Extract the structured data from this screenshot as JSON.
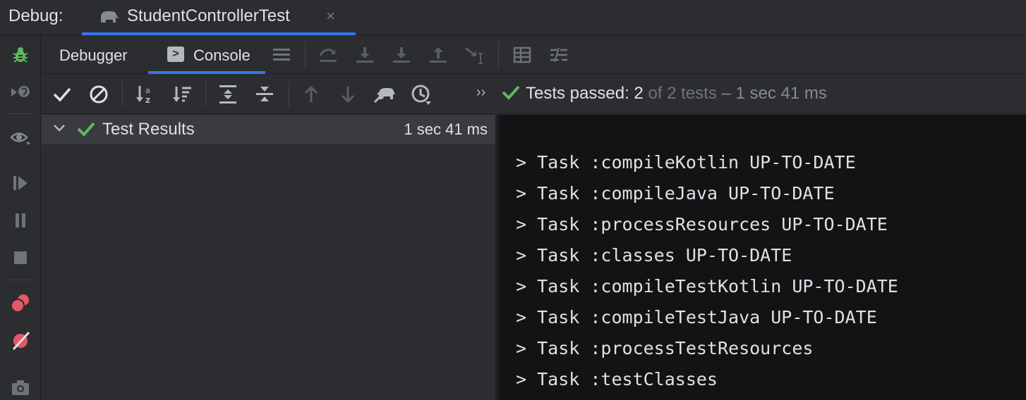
{
  "title_bar": {
    "debug_label": "Debug:",
    "run_tab_name": "StudentControllerTest",
    "close_glyph": "×",
    "run_icon": "gradle-elephant-icon"
  },
  "left_toolbar": {
    "icons": [
      "debug-bug-icon",
      "rerun-icon",
      "view-breakpoints-eye-icon",
      "resume-icon",
      "pause-icon",
      "stop-icon",
      "view-breakpoints-icon",
      "mute-breakpoints-icon",
      "camera-icon"
    ]
  },
  "tabs": {
    "debugger": "Debugger",
    "console": "Console",
    "console_glyph": ">"
  },
  "debugger_toolbar": {
    "icons": [
      "menu-icon",
      "step-over-icon",
      "step-into-icon",
      "force-step-into-icon",
      "step-out-icon",
      "run-to-cursor-icon",
      "evaluate-expression-icon",
      "trace-current-stream-icon"
    ]
  },
  "test_toolbar": {
    "icons": [
      "show-passed-icon",
      "show-ignored-icon",
      "sort-alphabetically-icon",
      "sort-by-duration-icon",
      "expand-all-icon",
      "collapse-all-icon",
      "previous-failed-icon",
      "next-failed-icon",
      "import-tests-icon",
      "test-history-icon"
    ],
    "more_glyph": "››",
    "status": {
      "passed": "Tests passed: 2",
      "of": "of 2 tests",
      "duration": "– 1 sec 41 ms"
    }
  },
  "test_results": {
    "root_label": "Test Results",
    "root_time": "1 sec 41 ms"
  },
  "console_output": {
    "lines": [
      "> Task :compileKotlin UP-TO-DATE",
      "> Task :compileJava UP-TO-DATE",
      "> Task :processResources UP-TO-DATE",
      "> Task :classes UP-TO-DATE",
      "> Task :compileTestKotlin UP-TO-DATE",
      "> Task :compileTestJava UP-TO-DATE",
      "> Task :processTestResources",
      "> Task :testClasses"
    ]
  },
  "colors": {
    "background": "#2b2d30",
    "console_background": "#121314",
    "accent": "#3574f0",
    "success": "#5fb85f",
    "breakpoint_red": "#e55765",
    "debug_green": "#5fb85f"
  }
}
